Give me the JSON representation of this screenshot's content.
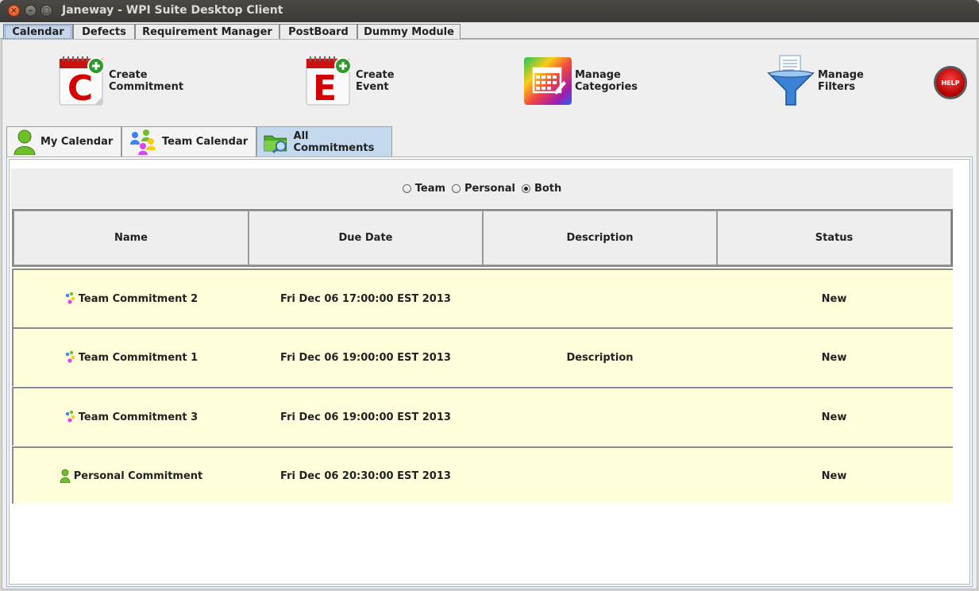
{
  "window": {
    "title": "Janeway - WPI Suite Desktop Client",
    "close_glyph": "×",
    "min_glyph": "–",
    "max_glyph": "□"
  },
  "module_tabs": [
    {
      "label": "Calendar",
      "active": true
    },
    {
      "label": "Defects",
      "active": false
    },
    {
      "label": "Requirement Manager",
      "active": false
    },
    {
      "label": "PostBoard",
      "active": false
    },
    {
      "label": "Dummy Module",
      "active": false
    }
  ],
  "toolbar": {
    "create_commitment": {
      "line1": "Create",
      "line2": "Commitment",
      "icon": "calendar-c-plus-icon"
    },
    "create_event": {
      "line1": "Create",
      "line2": "Event",
      "icon": "calendar-e-plus-icon"
    },
    "manage_categories": {
      "line1": "Manage",
      "line2": "Categories",
      "icon": "rainbow-calendar-icon"
    },
    "manage_filters": {
      "line1": "Manage",
      "line2": "Filters",
      "icon": "funnel-icon"
    },
    "help_label": "HELP"
  },
  "view_tabs": [
    {
      "label": "My Calendar",
      "icon": "person-icon",
      "active": false
    },
    {
      "label": "Team Calendar",
      "icon": "team-icon",
      "active": false
    },
    {
      "label": "All Commitments",
      "icon": "folder-search-icon",
      "active": true
    }
  ],
  "filter": {
    "options": [
      "Team",
      "Personal",
      "Both"
    ],
    "selected": "Both"
  },
  "table": {
    "columns": [
      "Name",
      "Due Date",
      "Description",
      "Status"
    ],
    "rows": [
      {
        "name": "Team Commitment 2",
        "type": "team",
        "due": "Fri Dec 06 17:00:00 EST 2013",
        "description": "",
        "status": "New"
      },
      {
        "name": "Team Commitment 1",
        "type": "team",
        "due": "Fri Dec 06 19:00:00 EST 2013",
        "description": "Description",
        "status": "New"
      },
      {
        "name": "Team Commitment 3",
        "type": "team",
        "due": "Fri Dec 06 19:00:00 EST 2013",
        "description": "",
        "status": "New"
      },
      {
        "name": "Personal Commitment",
        "type": "personal",
        "due": "Fri Dec 06 20:30:00 EST 2013",
        "description": "",
        "status": "New"
      }
    ]
  },
  "colors": {
    "row_bg": "#ffffdc",
    "active_tab": "#c5d9ee",
    "help_red": "#d40000"
  }
}
